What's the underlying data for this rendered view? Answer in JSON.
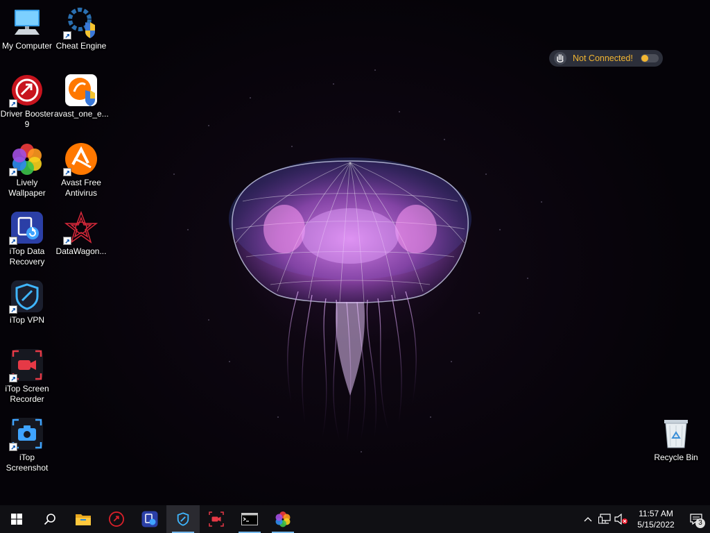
{
  "desktop": {
    "icons": [
      {
        "label": "My Computer"
      },
      {
        "label": "Cheat Engine"
      },
      {
        "label": "Driver Booster 9"
      },
      {
        "label": "avast_one_e..."
      },
      {
        "label": "Lively Wallpaper"
      },
      {
        "label": "Avast Free Antivirus"
      },
      {
        "label": "iTop Data Recovery"
      },
      {
        "label": "DataWagon..."
      },
      {
        "label": "iTop VPN"
      },
      {
        "label": "iTop Screen Recorder"
      },
      {
        "label": "iTop Screenshot"
      },
      {
        "label": "Recycle Bin"
      }
    ]
  },
  "vpn_widget": {
    "status": "Not Connected!",
    "status_color": "#f2b632"
  },
  "taskbar": {
    "pinned": [
      {
        "icon": "windows-start-icon",
        "name": "Start"
      },
      {
        "icon": "search-icon",
        "name": "Search"
      },
      {
        "icon": "folder-icon",
        "name": "File Explorer"
      },
      {
        "icon": "driver-booster-icon",
        "name": "Driver Booster"
      },
      {
        "icon": "itop-data-recovery-icon",
        "name": "iTop Data Recovery"
      },
      {
        "icon": "itop-vpn-icon",
        "name": "iTop VPN"
      },
      {
        "icon": "itop-screen-recorder-icon",
        "name": "iTop Screen Recorder"
      },
      {
        "icon": "terminal-icon",
        "name": "Command Prompt"
      },
      {
        "icon": "lively-wallpaper-icon",
        "name": "Lively Wallpaper"
      }
    ],
    "tray": {
      "icons": [
        "chevron-up-icon",
        "network-icon",
        "volume-muted-icon"
      ],
      "time": "11:57 AM",
      "date": "5/15/2022",
      "notification_count": "3"
    }
  },
  "colors": {
    "taskbar_bg": "#101014",
    "accent": "#76b9ed",
    "jellyfish": "#c46ad8"
  }
}
